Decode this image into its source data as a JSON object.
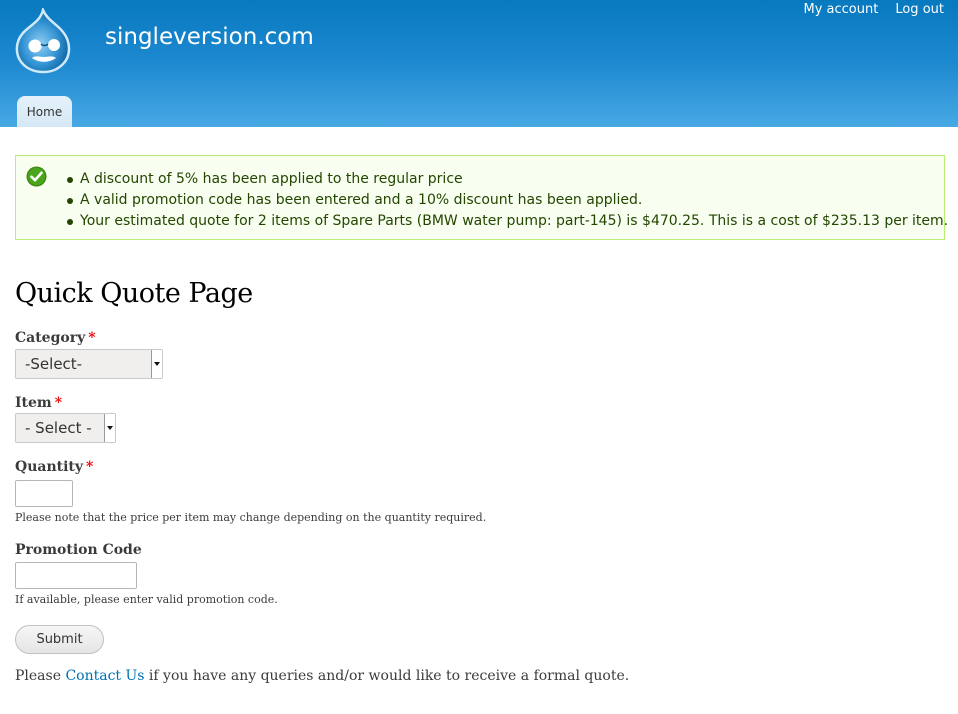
{
  "header": {
    "site_name": "singleversion.com",
    "secondary_menu": [
      "My account",
      "Log out"
    ],
    "main_menu": [
      "Home"
    ]
  },
  "messages": {
    "type": "status",
    "items": [
      "A discount of 5% has been applied to the regular price",
      "A valid promotion code has been entered and a 10% discount has been applied.",
      "Your estimated quote for 2 items of Spare Parts (BMW water pump: part-145) is $470.25. This is a cost of $235.13 per item."
    ]
  },
  "page": {
    "title": "Quick Quote Page"
  },
  "form": {
    "category": {
      "label": "Category",
      "required_mark": "*",
      "selected": "-Select-"
    },
    "item": {
      "label": "Item",
      "required_mark": "*",
      "selected": "- Select -"
    },
    "quantity": {
      "label": "Quantity",
      "required_mark": "*",
      "value": "",
      "description": "Please note that the price per item may change depending on the quantity required."
    },
    "promotion": {
      "label": "Promotion Code",
      "value": "",
      "description": "If available, please enter valid promotion code."
    },
    "submit_label": "Submit"
  },
  "footer_note": {
    "before": "Please ",
    "link": "Contact Us",
    "after": " if you have any queries and/or would like to receive a formal quote."
  },
  "colors": {
    "header_top": "#0779bf",
    "header_bottom": "#48a9e4",
    "message_bg": "#f8fff0",
    "message_text": "#234600",
    "required": "#ee0000",
    "link": "#0071b3"
  }
}
